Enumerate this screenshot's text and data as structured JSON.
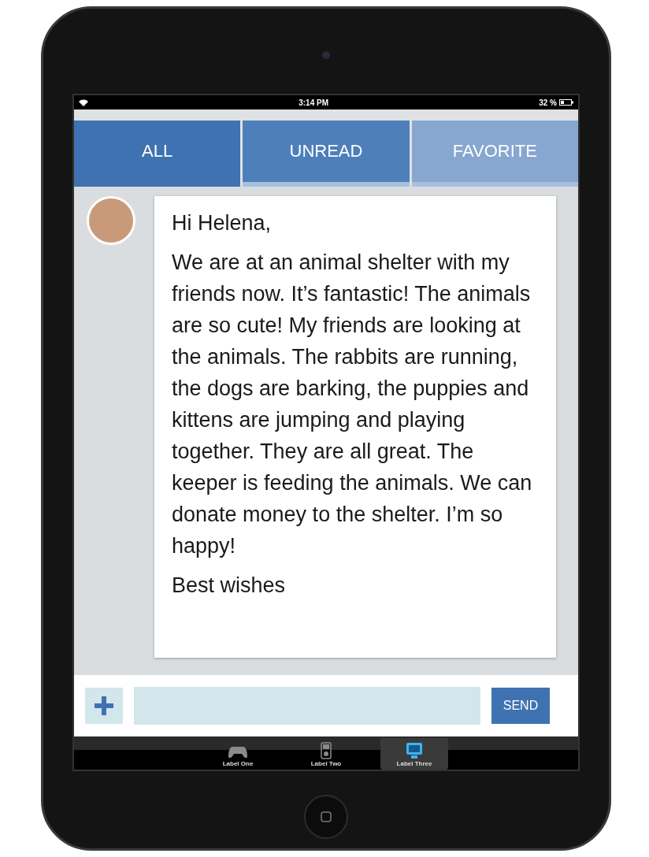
{
  "status_bar": {
    "time": "3:14 PM",
    "battery": "32 %"
  },
  "tabs": [
    {
      "label": "ALL",
      "selected": true
    },
    {
      "label": "UNREAD",
      "selected": false
    },
    {
      "label": "FAVORITE",
      "selected": false
    }
  ],
  "message": {
    "paragraphs": [
      "Hi Helena,",
      "We are at an animal shelter with my friends now. It’s fantastic! The animals are so cute! My friends are looking at the animals. The rabbits are running, the dogs are barking, the puppies and kittens are jumping and playing together. They are all great. The keeper is feeding the animals. We can donate money to the shelter. I’m so happy!",
      "Best wishes"
    ]
  },
  "composer": {
    "send": "SEND"
  },
  "tab_bar": [
    {
      "label": "Label One",
      "kind": "gamepad",
      "selected": false
    },
    {
      "label": "Label Two",
      "kind": "player",
      "selected": false
    },
    {
      "label": "Label Three",
      "kind": "monitor",
      "selected": true
    }
  ]
}
